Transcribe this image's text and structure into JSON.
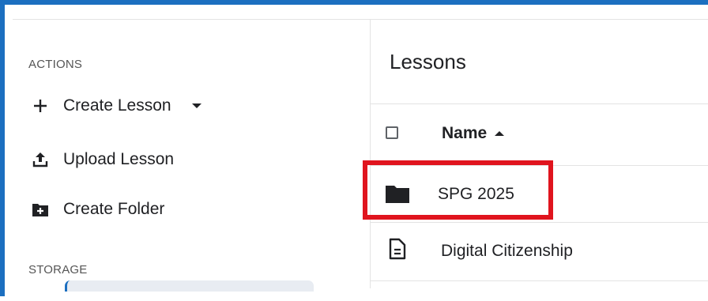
{
  "sidebar": {
    "actions_heading": "ACTIONS",
    "actions": [
      {
        "label": "Create Lesson",
        "icon": "plus-icon",
        "has_dropdown": true
      },
      {
        "label": "Upload Lesson",
        "icon": "upload-icon",
        "has_dropdown": false
      },
      {
        "label": "Create Folder",
        "icon": "create-folder-icon",
        "has_dropdown": false
      }
    ],
    "storage_heading": "STORAGE"
  },
  "main": {
    "title": "Lessons",
    "table": {
      "columns": [
        {
          "label": "Name",
          "sort": "ascending"
        }
      ],
      "rows": [
        {
          "name": "SPG 2025",
          "icon": "folder-icon",
          "highlighted": true
        },
        {
          "name": "Digital Citizenship",
          "icon": "document-icon",
          "highlighted": false
        }
      ]
    }
  },
  "colors": {
    "accent": "#1c6fc0",
    "highlight": "#e0141e",
    "text": "#202124",
    "muted": "#555555",
    "divider": "#e3e3e3"
  }
}
